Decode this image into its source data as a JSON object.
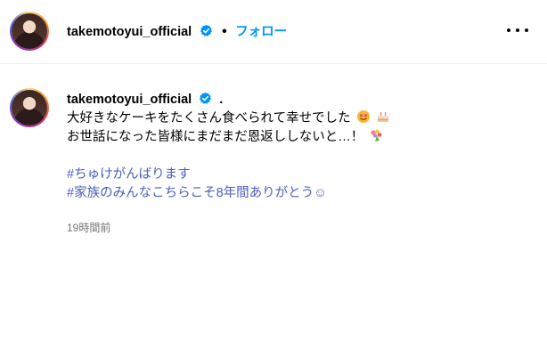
{
  "header": {
    "username": "takemotoyui_official",
    "separator": "•",
    "follow_label": "フォロー"
  },
  "post": {
    "username": "takemotoyui_official",
    "separator": ".",
    "caption_lines": [
      "大好きなケーキをたくさん食べられて幸せでした",
      "お世話になった皆様にまだまだ恩返ししないと…！"
    ],
    "hashtags": [
      "#ちゅけがんばります",
      "#家族のみんなこちらこそ8年間ありがとう☺"
    ],
    "timestamp": "19時間前",
    "emojis": [
      "smiling-face-emoji",
      "cake-emoji",
      "bouquet-emoji"
    ]
  },
  "colors": {
    "follow": "#0095f6",
    "hashtag": "#4b5fbe",
    "verified": "#0095f6",
    "timestamp": "#737373"
  }
}
